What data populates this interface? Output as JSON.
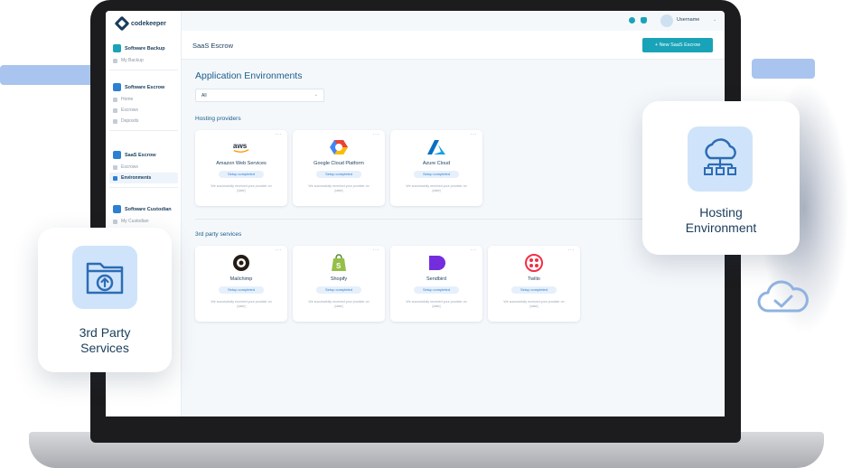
{
  "app": {
    "logo_text": "codekeeper"
  },
  "sidebar": {
    "sections": [
      {
        "label": "Software Backup",
        "icon": "backup-icon",
        "items": [
          {
            "label": "My Backup"
          }
        ]
      },
      {
        "label": "Software Escrow",
        "icon": "escrow-icon",
        "items": [
          {
            "label": "Home"
          },
          {
            "label": "Escrows"
          },
          {
            "label": "Deposits"
          }
        ]
      },
      {
        "label": "SaaS Escrow",
        "icon": "saas-escrow-icon",
        "items": [
          {
            "label": "Escrows"
          },
          {
            "label": "Environments",
            "active": true
          }
        ]
      },
      {
        "label": "Software Custodian",
        "icon": "custodian-icon",
        "items": [
          {
            "label": "My Custodian"
          }
        ]
      }
    ]
  },
  "topbar": {
    "username": "Username"
  },
  "header": {
    "title": "SaaS Escrow",
    "new_button": "+ New SaaS Escrow"
  },
  "main": {
    "title": "Application Environments",
    "filter_value": "All",
    "hosting_title": "Hosting providers",
    "third_party_title": "3rd party services",
    "hosting": [
      {
        "name": "Amazon Web Services",
        "logo": "aws-logo",
        "badge": "Setup completed",
        "desc": "We successfully received your provider on [date]"
      },
      {
        "name": "Google Cloud Platform",
        "logo": "gcp-logo",
        "badge": "Setup completed",
        "desc": "We successfully received your provider on [date]"
      },
      {
        "name": "Azure Cloud",
        "logo": "azure-logo",
        "badge": "Setup completed",
        "desc": "We successfully received your provider on [date]"
      }
    ],
    "third_party": [
      {
        "name": "Mailchimp",
        "logo": "mailchimp-logo",
        "badge": "Setup completed",
        "desc": "We successfully received your provider on [date]"
      },
      {
        "name": "Shopify",
        "logo": "shopify-logo",
        "badge": "Setup completed",
        "desc": "We successfully received your provider on [date]"
      },
      {
        "name": "Sendbird",
        "logo": "sendbird-logo",
        "badge": "Setup completed",
        "desc": "We successfully received your provider on [date]"
      },
      {
        "name": "Twilio",
        "logo": "twilio-logo",
        "badge": "Setup completed",
        "desc": "We successfully received your provider on [date]"
      }
    ]
  },
  "floating": {
    "third_party_label_line1": "3rd Party",
    "third_party_label_line2": "Services",
    "hosting_label_line1": "Hosting",
    "hosting_label_line2": "Environment"
  },
  "colors": {
    "accent": "#19a3b8",
    "navy": "#1a3d5c",
    "blue": "#2d7fd1",
    "icon_bg": "#cfe4fa"
  }
}
